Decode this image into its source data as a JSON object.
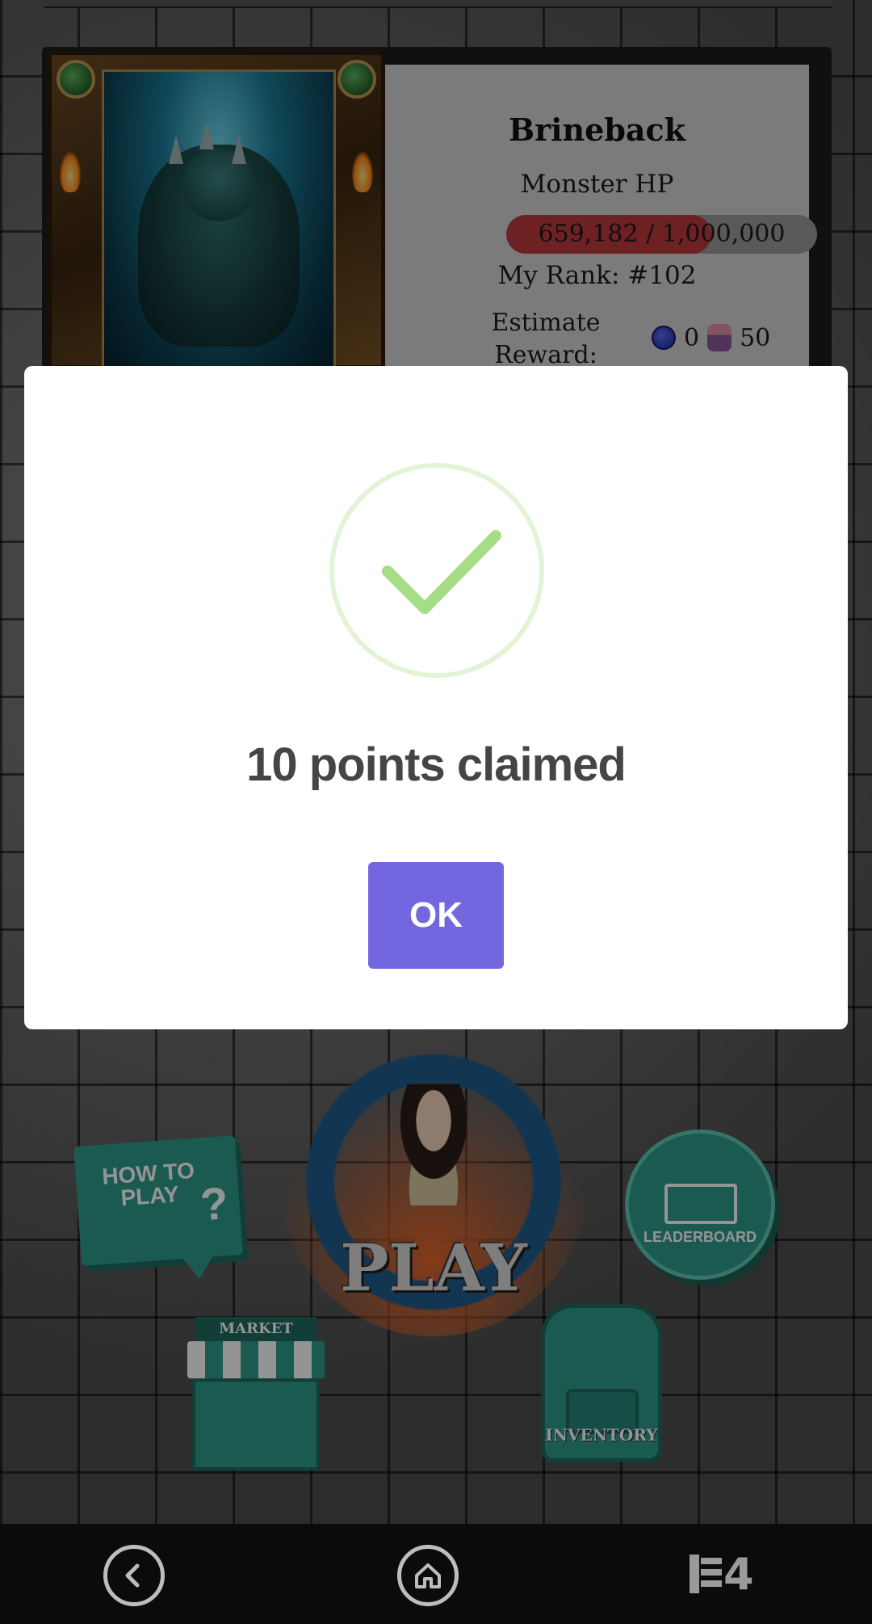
{
  "boss": {
    "name": "Brineback",
    "hp_label": "Monster HP",
    "hp_text": "659,182 / 1,000,000",
    "hp_fraction": 0.659,
    "rank": "My Rank: #102",
    "estimate_label": "Estimate Reward:",
    "reward_coin": "0",
    "reward_points": "50"
  },
  "modal": {
    "icon": "success-check-icon",
    "title": "10 points claimed",
    "ok_label": "OK"
  },
  "menu": {
    "how_to_play": "HOW TO PLAY",
    "play": "PLAY",
    "leaderboard": "LEADERBOARD",
    "market": "MARKET",
    "inventory": "INVENTORY"
  },
  "nav": {
    "back_icon": "chevron-left-icon",
    "home_icon": "home-icon",
    "logo": "4"
  },
  "colors": {
    "accent": "#7367e0",
    "success": "#a5dc86",
    "hp_fill": "#bd3a3c",
    "teal": "#2e9c8a"
  }
}
